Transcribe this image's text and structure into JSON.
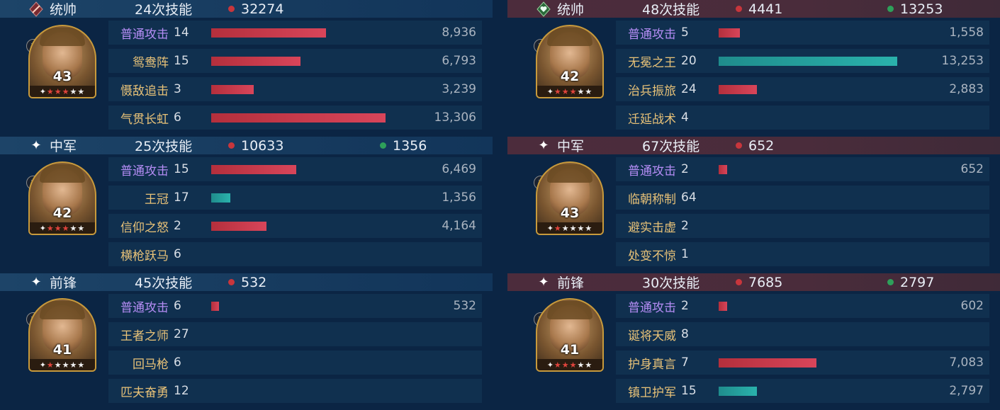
{
  "colors": {
    "damage": "#c8363c",
    "heal": "#2ea05a",
    "bar_damage": "#d8455a",
    "bar_heal": "#2ab2ac",
    "ally_header": "#1d4468",
    "enemy_header": "#4c2c3c"
  },
  "left": [
    {
      "role_icon": "sword-icon",
      "role": "统帅",
      "skill_count": "24次技能",
      "damage": "32274",
      "heal": "",
      "level": "43",
      "stars": [
        "red",
        "red",
        "red",
        "white",
        "white"
      ],
      "skills": [
        {
          "name": "普通攻击",
          "color": "purple",
          "count": "14",
          "bar": 0.27,
          "bar_type": "red",
          "value": "8,936"
        },
        {
          "name": "鸳鸯阵",
          "color": "gold",
          "count": "15",
          "bar": 0.21,
          "bar_type": "red",
          "value": "6,793"
        },
        {
          "name": "慑敌追击",
          "color": "gold",
          "count": "3",
          "bar": 0.1,
          "bar_type": "red",
          "value": "3,239"
        },
        {
          "name": "气贯长虹",
          "color": "gold",
          "count": "6",
          "bar": 0.41,
          "bar_type": "red",
          "value": "13,306"
        }
      ]
    },
    {
      "role_icon": "sparkle-icon",
      "role": "中军",
      "skill_count": "25次技能",
      "damage": "10633",
      "heal": "1356",
      "level": "42",
      "stars": [
        "red",
        "red",
        "red",
        "white",
        "white"
      ],
      "skills": [
        {
          "name": "普通攻击",
          "color": "purple",
          "count": "15",
          "bar": 0.2,
          "bar_type": "red",
          "value": "6,469"
        },
        {
          "name": "王冠",
          "color": "gold",
          "count": "17",
          "bar": 0.045,
          "bar_type": "teal",
          "value": "1,356"
        },
        {
          "name": "信仰之怒",
          "color": "gold",
          "count": "2",
          "bar": 0.13,
          "bar_type": "red",
          "value": "4,164"
        },
        {
          "name": "横枪跃马",
          "color": "gold",
          "count": "6",
          "bar": 0,
          "bar_type": "red",
          "value": ""
        }
      ]
    },
    {
      "role_icon": "sparkle-icon",
      "role": "前锋",
      "skill_count": "45次技能",
      "damage": "532",
      "heal": "",
      "level": "41",
      "stars": [
        "red",
        "white",
        "white",
        "white",
        "white"
      ],
      "skills": [
        {
          "name": "普通攻击",
          "color": "purple",
          "count": "6",
          "bar": 0.018,
          "bar_type": "red",
          "value": "532"
        },
        {
          "name": "王者之师",
          "color": "gold",
          "count": "27",
          "bar": 0,
          "bar_type": "red",
          "value": ""
        },
        {
          "name": "回马枪",
          "color": "gold",
          "count": "6",
          "bar": 0,
          "bar_type": "red",
          "value": ""
        },
        {
          "name": "匹夫奋勇",
          "color": "gold",
          "count": "12",
          "bar": 0,
          "bar_type": "red",
          "value": ""
        }
      ]
    }
  ],
  "right": [
    {
      "role_icon": "heart-icon",
      "role": "统帅",
      "skill_count": "48次技能",
      "damage": "4441",
      "heal": "13253",
      "level": "42",
      "stars": [
        "red",
        "red",
        "red",
        "white",
        "white"
      ],
      "skills": [
        {
          "name": "普通攻击",
          "color": "purple",
          "count": "5",
          "bar": 0.05,
          "bar_type": "red",
          "value": "1,558"
        },
        {
          "name": "无冕之王",
          "color": "gold",
          "count": "20",
          "bar": 0.42,
          "bar_type": "teal",
          "value": "13,253"
        },
        {
          "name": "治兵振旅",
          "color": "gold",
          "count": "24",
          "bar": 0.09,
          "bar_type": "red",
          "value": "2,883"
        },
        {
          "name": "迁延战术",
          "color": "gold",
          "count": "4",
          "bar": 0,
          "bar_type": "red",
          "value": ""
        }
      ]
    },
    {
      "role_icon": "sparkle-icon",
      "role": "中军",
      "skill_count": "67次技能",
      "damage": "652",
      "heal": "",
      "level": "43",
      "stars": [
        "red",
        "white",
        "white",
        "white",
        "white"
      ],
      "skills": [
        {
          "name": "普通攻击",
          "color": "purple",
          "count": "2",
          "bar": 0.02,
          "bar_type": "red",
          "value": "652"
        },
        {
          "name": "临朝称制",
          "color": "gold",
          "count": "64",
          "bar": 0,
          "bar_type": "red",
          "value": ""
        },
        {
          "name": "避实击虚",
          "color": "gold",
          "count": "2",
          "bar": 0,
          "bar_type": "red",
          "value": ""
        },
        {
          "name": "处变不惊",
          "color": "gold",
          "count": "1",
          "bar": 0,
          "bar_type": "red",
          "value": ""
        }
      ]
    },
    {
      "role_icon": "sparkle-icon",
      "role": "前锋",
      "skill_count": "30次技能",
      "damage": "7685",
      "heal": "2797",
      "level": "41",
      "stars": [
        "red",
        "red",
        "red",
        "white",
        "white"
      ],
      "skills": [
        {
          "name": "普通攻击",
          "color": "purple",
          "count": "2",
          "bar": 0.02,
          "bar_type": "red",
          "value": "602"
        },
        {
          "name": "诞将天威",
          "color": "gold",
          "count": "8",
          "bar": 0,
          "bar_type": "red",
          "value": ""
        },
        {
          "name": "护身真言",
          "color": "gold",
          "count": "7",
          "bar": 0.23,
          "bar_type": "red",
          "value": "7,083"
        },
        {
          "name": "镇卫护军",
          "color": "gold",
          "count": "15",
          "bar": 0.09,
          "bar_type": "teal",
          "value": "2,797"
        }
      ]
    }
  ]
}
